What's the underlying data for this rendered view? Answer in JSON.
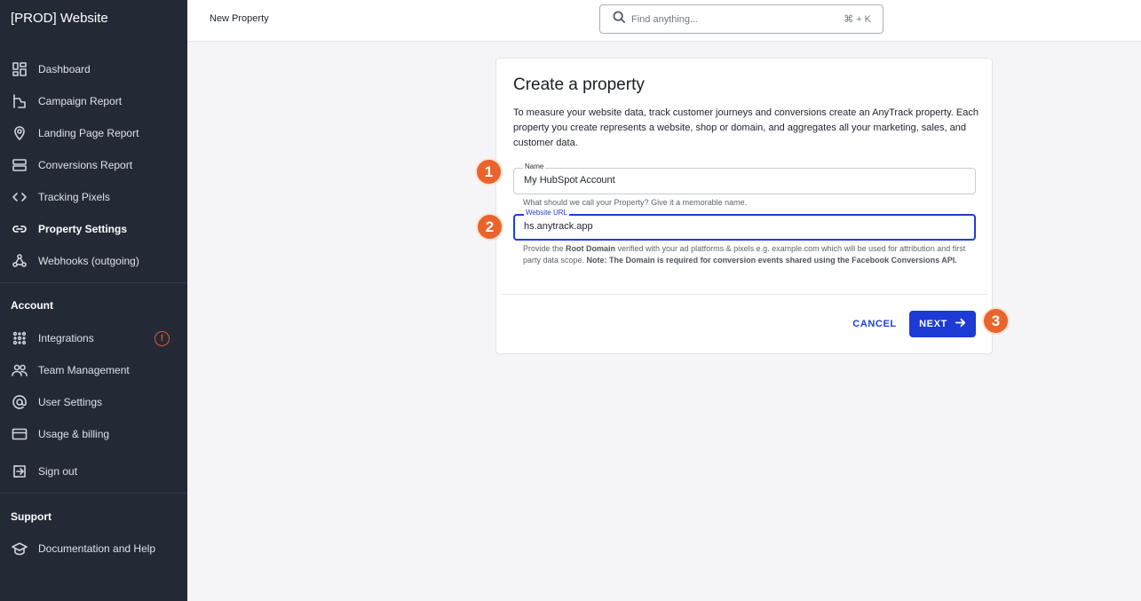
{
  "app": {
    "workspace_name": "[PROD] Website"
  },
  "sidebar": {
    "items": [
      {
        "label": "Dashboard",
        "icon": "dashboard-icon"
      },
      {
        "label": "Campaign Report",
        "icon": "campaign-icon"
      },
      {
        "label": "Landing Page Report",
        "icon": "location-pin-icon"
      },
      {
        "label": "Conversions Report",
        "icon": "server-icon"
      },
      {
        "label": "Tracking Pixels",
        "icon": "code-icon"
      },
      {
        "label": "Property Settings",
        "icon": "link-icon",
        "active": true
      },
      {
        "label": "Webhooks (outgoing)",
        "icon": "webhook-icon"
      }
    ],
    "account_title": "Account",
    "account_items": [
      {
        "label": "Integrations",
        "icon": "integrations-icon",
        "badge_icon": "warning-icon"
      },
      {
        "label": "Team Management",
        "icon": "team-icon"
      },
      {
        "label": "User Settings",
        "icon": "at-sign-icon"
      },
      {
        "label": "Usage & billing",
        "icon": "credit-card-icon"
      }
    ],
    "sign_out": {
      "label": "Sign out",
      "icon": "sign-out-icon"
    },
    "support_title": "Support",
    "support_items": [
      {
        "label": "Documentation and Help",
        "icon": "graduation-cap-icon"
      }
    ]
  },
  "header": {
    "title": "New Property",
    "search": {
      "placeholder": "Find anything...",
      "shortcut": "⌘ + K"
    }
  },
  "form": {
    "title": "Create a property",
    "intro": "To measure your website data, track customer journeys and conversions create an AnyTrack property. Each property you create represents a website, shop or domain, and aggregates all your marketing, sales, and customer data.",
    "name_field": {
      "label": "Name",
      "value": "My HubSpot Account",
      "help": "What should we call your Property? Give it a memorable name."
    },
    "url_field": {
      "label": "Website URL",
      "value": "hs.anytrack.app",
      "help_prefix": "Provide the ",
      "help_bold1": "Root Domain",
      "help_middle": " verified with your ad platforms & pixels e.g. example.com which will be used for attribution and first party data scope. ",
      "help_bold2": "Note: The Domain is required for conversion events shared using the Facebook Conversions API."
    },
    "cancel_label": "CANCEL",
    "next_label": "NEXT"
  },
  "steps": [
    "1",
    "2",
    "3"
  ],
  "colors": {
    "sidebar_bg": "#242a35",
    "primary": "#1b3bd4",
    "step_badge": "#e8642c",
    "warning": "#e0573b"
  }
}
